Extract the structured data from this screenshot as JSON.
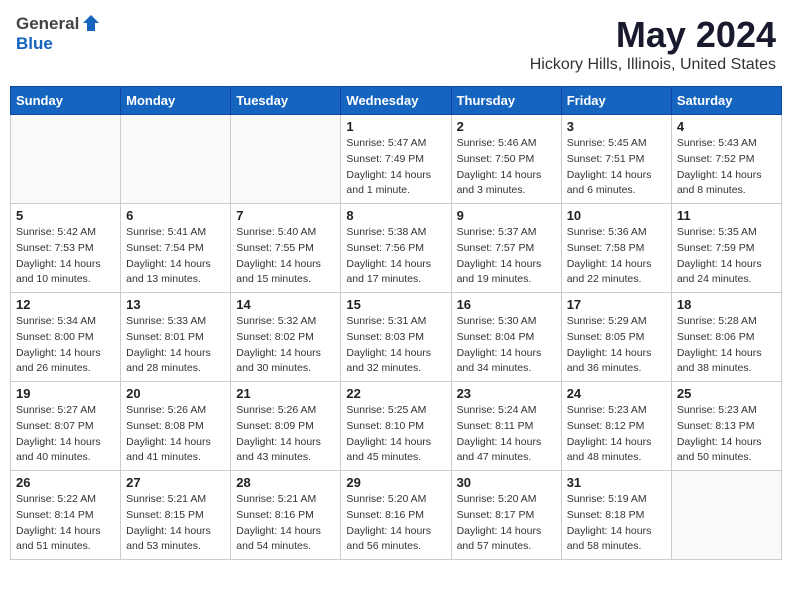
{
  "header": {
    "logo_general": "General",
    "logo_blue": "Blue",
    "month_title": "May 2024",
    "location": "Hickory Hills, Illinois, United States"
  },
  "weekdays": [
    "Sunday",
    "Monday",
    "Tuesday",
    "Wednesday",
    "Thursday",
    "Friday",
    "Saturday"
  ],
  "weeks": [
    [
      {
        "day": "",
        "info": ""
      },
      {
        "day": "",
        "info": ""
      },
      {
        "day": "",
        "info": ""
      },
      {
        "day": "1",
        "info": "Sunrise: 5:47 AM\nSunset: 7:49 PM\nDaylight: 14 hours\nand 1 minute."
      },
      {
        "day": "2",
        "info": "Sunrise: 5:46 AM\nSunset: 7:50 PM\nDaylight: 14 hours\nand 3 minutes."
      },
      {
        "day": "3",
        "info": "Sunrise: 5:45 AM\nSunset: 7:51 PM\nDaylight: 14 hours\nand 6 minutes."
      },
      {
        "day": "4",
        "info": "Sunrise: 5:43 AM\nSunset: 7:52 PM\nDaylight: 14 hours\nand 8 minutes."
      }
    ],
    [
      {
        "day": "5",
        "info": "Sunrise: 5:42 AM\nSunset: 7:53 PM\nDaylight: 14 hours\nand 10 minutes."
      },
      {
        "day": "6",
        "info": "Sunrise: 5:41 AM\nSunset: 7:54 PM\nDaylight: 14 hours\nand 13 minutes."
      },
      {
        "day": "7",
        "info": "Sunrise: 5:40 AM\nSunset: 7:55 PM\nDaylight: 14 hours\nand 15 minutes."
      },
      {
        "day": "8",
        "info": "Sunrise: 5:38 AM\nSunset: 7:56 PM\nDaylight: 14 hours\nand 17 minutes."
      },
      {
        "day": "9",
        "info": "Sunrise: 5:37 AM\nSunset: 7:57 PM\nDaylight: 14 hours\nand 19 minutes."
      },
      {
        "day": "10",
        "info": "Sunrise: 5:36 AM\nSunset: 7:58 PM\nDaylight: 14 hours\nand 22 minutes."
      },
      {
        "day": "11",
        "info": "Sunrise: 5:35 AM\nSunset: 7:59 PM\nDaylight: 14 hours\nand 24 minutes."
      }
    ],
    [
      {
        "day": "12",
        "info": "Sunrise: 5:34 AM\nSunset: 8:00 PM\nDaylight: 14 hours\nand 26 minutes."
      },
      {
        "day": "13",
        "info": "Sunrise: 5:33 AM\nSunset: 8:01 PM\nDaylight: 14 hours\nand 28 minutes."
      },
      {
        "day": "14",
        "info": "Sunrise: 5:32 AM\nSunset: 8:02 PM\nDaylight: 14 hours\nand 30 minutes."
      },
      {
        "day": "15",
        "info": "Sunrise: 5:31 AM\nSunset: 8:03 PM\nDaylight: 14 hours\nand 32 minutes."
      },
      {
        "day": "16",
        "info": "Sunrise: 5:30 AM\nSunset: 8:04 PM\nDaylight: 14 hours\nand 34 minutes."
      },
      {
        "day": "17",
        "info": "Sunrise: 5:29 AM\nSunset: 8:05 PM\nDaylight: 14 hours\nand 36 minutes."
      },
      {
        "day": "18",
        "info": "Sunrise: 5:28 AM\nSunset: 8:06 PM\nDaylight: 14 hours\nand 38 minutes."
      }
    ],
    [
      {
        "day": "19",
        "info": "Sunrise: 5:27 AM\nSunset: 8:07 PM\nDaylight: 14 hours\nand 40 minutes."
      },
      {
        "day": "20",
        "info": "Sunrise: 5:26 AM\nSunset: 8:08 PM\nDaylight: 14 hours\nand 41 minutes."
      },
      {
        "day": "21",
        "info": "Sunrise: 5:26 AM\nSunset: 8:09 PM\nDaylight: 14 hours\nand 43 minutes."
      },
      {
        "day": "22",
        "info": "Sunrise: 5:25 AM\nSunset: 8:10 PM\nDaylight: 14 hours\nand 45 minutes."
      },
      {
        "day": "23",
        "info": "Sunrise: 5:24 AM\nSunset: 8:11 PM\nDaylight: 14 hours\nand 47 minutes."
      },
      {
        "day": "24",
        "info": "Sunrise: 5:23 AM\nSunset: 8:12 PM\nDaylight: 14 hours\nand 48 minutes."
      },
      {
        "day": "25",
        "info": "Sunrise: 5:23 AM\nSunset: 8:13 PM\nDaylight: 14 hours\nand 50 minutes."
      }
    ],
    [
      {
        "day": "26",
        "info": "Sunrise: 5:22 AM\nSunset: 8:14 PM\nDaylight: 14 hours\nand 51 minutes."
      },
      {
        "day": "27",
        "info": "Sunrise: 5:21 AM\nSunset: 8:15 PM\nDaylight: 14 hours\nand 53 minutes."
      },
      {
        "day": "28",
        "info": "Sunrise: 5:21 AM\nSunset: 8:16 PM\nDaylight: 14 hours\nand 54 minutes."
      },
      {
        "day": "29",
        "info": "Sunrise: 5:20 AM\nSunset: 8:16 PM\nDaylight: 14 hours\nand 56 minutes."
      },
      {
        "day": "30",
        "info": "Sunrise: 5:20 AM\nSunset: 8:17 PM\nDaylight: 14 hours\nand 57 minutes."
      },
      {
        "day": "31",
        "info": "Sunrise: 5:19 AM\nSunset: 8:18 PM\nDaylight: 14 hours\nand 58 minutes."
      },
      {
        "day": "",
        "info": ""
      }
    ]
  ]
}
